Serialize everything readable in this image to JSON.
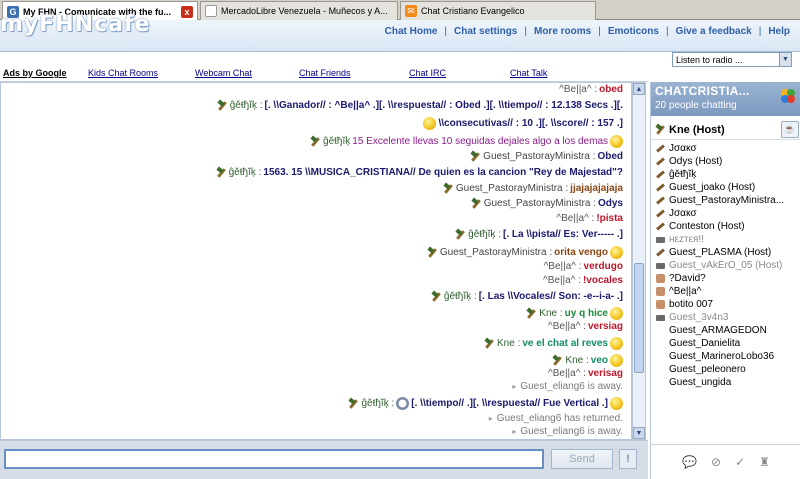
{
  "browser": {
    "tabs": [
      {
        "title": "My FHN - Comunicate with the fu...",
        "active": true,
        "icon": "browser-g-icon",
        "icon_color": "#3a6fb0"
      },
      {
        "title": "MercadoLibre Venezuela - Muñecos y A...",
        "active": false,
        "icon": "document-icon",
        "icon_color": "#9a9a9a"
      },
      {
        "title": "Chat Cristiano Evangelico",
        "active": false,
        "icon": "messenger-icon",
        "icon_color": "#f08a1c"
      }
    ],
    "close_glyph": "x"
  },
  "header": {
    "logo_text": "myFHNcafe",
    "nav": [
      "Chat Home",
      "Chat settings",
      "More rooms",
      "Emoticons",
      "Give a feedback",
      "Help"
    ]
  },
  "ads": {
    "title": "Ads by Google",
    "links": [
      "Kids Chat Rooms",
      "Webcam Chat",
      "Chat Friends",
      "Chat IRC",
      "Chat Talk"
    ]
  },
  "radio": {
    "selected": "Listen to radio ..."
  },
  "chat": {
    "lines": [
      {
        "nick": "^Be||a^ :",
        "msg": "obed",
        "style": "msg-red"
      },
      {
        "nick": "ĝěŧђĭķ :",
        "msg": "[. \\\\Ganador// : ^Be||a^ .][. \\\\respuesta// : Obed .][. \\\\tiempo// : 12.138 Secs .][.",
        "style": "msg-navy"
      },
      {
        "nick": "",
        "msg": "\\\\consecutivas// : 10 .][. \\\\score// : 157 .]",
        "style": "msg-navy"
      },
      {
        "nick": "ĝěŧђĭķ",
        "msg": "15 Excelente llevas 10 seguidas dejales algo a los demas",
        "style": "msg-purple"
      },
      {
        "nick": "Guest_PastorayMinistra :",
        "msg": "Obed",
        "style": "msg-dark"
      },
      {
        "nick": "ĝěŧђĭķ :",
        "msg": "1563. 15 \\\\MUSICA_CRISTIANA// De quien es la cancion \"Rey de Majestad\"?",
        "style": "msg-navy"
      },
      {
        "nick": "Guest_PastorayMinistra :",
        "msg": "jjajajajajaja",
        "style": "msg-brown"
      },
      {
        "nick": "Guest_PastorayMinistra :",
        "msg": "Odys",
        "style": "msg-dark"
      },
      {
        "nick": "^Be||a^ :",
        "msg": "!pista",
        "style": "msg-red"
      },
      {
        "nick": "ĝěŧђĭķ :",
        "msg": "[. La \\\\pista// Es: Ver----- .]",
        "style": "msg-navy"
      },
      {
        "nick": "Guest_PastorayMinistra :",
        "msg": "orita vengo",
        "style": "msg-brown"
      },
      {
        "nick": "^Be||a^ :",
        "msg": "verdugo",
        "style": "msg-red"
      },
      {
        "nick": "^Be||a^ :",
        "msg": "!vocales",
        "style": "msg-red"
      },
      {
        "nick": "ĝěŧђĭķ :",
        "msg": "[. Las \\\\Vocales// Son: -e--i-a- .]",
        "style": "msg-navy"
      },
      {
        "nick": "Kne :",
        "msg": "uy q hice",
        "style": "msg-green"
      },
      {
        "nick": "^Be||a^ :",
        "msg": "versiag",
        "style": "msg-red"
      },
      {
        "nick": "Kne :",
        "msg": "ve el chat al reves",
        "style": "msg-teal"
      },
      {
        "nick": "Kne :",
        "msg": "veo",
        "style": "msg-teal"
      },
      {
        "nick": "^Be||a^ :",
        "msg": "verisag",
        "style": "msg-red"
      },
      {
        "nick": "",
        "msg": "Guest_eliang6 is away.",
        "style": "sys"
      },
      {
        "nick": "ĝěŧђĭķ :",
        "msg": "[. \\\\tiempo// .][. \\\\respuesta// Fue Vertical .]",
        "style": "msg-navy"
      },
      {
        "nick": "",
        "msg": "Guest_eliang6 has returned.",
        "style": "sys"
      },
      {
        "nick": "",
        "msg": "Guest_eliang6 is away.",
        "style": "sys"
      }
    ]
  },
  "room": {
    "title": "CHATCRISTIA...",
    "count_text": "20 people chatting",
    "host": "Kne (Host)",
    "users": [
      {
        "name": "Jσαкσ",
        "icon": "hammer",
        "grayed": false
      },
      {
        "name": "Odys (Host)",
        "icon": "hammer",
        "grayed": false
      },
      {
        "name": "ĝěŧђĭķ",
        "icon": "hammer",
        "grayed": false
      },
      {
        "name": "Guest_joako (Host)",
        "icon": "hammer",
        "grayed": false
      },
      {
        "name": "Guest_PastorayMinistra...",
        "icon": "hammer",
        "grayed": false
      },
      {
        "name": "Jσαкσ",
        "icon": "hammer",
        "grayed": false
      },
      {
        "name": "Conteston (Host)",
        "icon": "hammer",
        "grayed": false
      },
      {
        "name": "нεzтεя!!",
        "icon": "cam",
        "grayed": true
      },
      {
        "name": "Guest_PLASMA (Host)",
        "icon": "hammer",
        "grayed": false
      },
      {
        "name": "Guest_vAkErO_05 (Host)",
        "icon": "cam",
        "grayed": true
      },
      {
        "name": "?David?",
        "icon": "face",
        "grayed": false
      },
      {
        "name": "^Be||a^",
        "icon": "face",
        "grayed": false
      },
      {
        "name": "botito 007",
        "icon": "face",
        "grayed": false
      },
      {
        "name": "Guest_3v4n3",
        "icon": "cam",
        "grayed": true
      },
      {
        "name": "Guest_ARMAGEDON",
        "icon": "",
        "grayed": false
      },
      {
        "name": "Guest_Danielita",
        "icon": "",
        "grayed": false
      },
      {
        "name": "Guest_MarineroLobo36",
        "icon": "",
        "grayed": false
      },
      {
        "name": "Guest_peleonero",
        "icon": "",
        "grayed": false
      },
      {
        "name": "Guest_ungida",
        "icon": "",
        "grayed": false
      }
    ]
  },
  "input": {
    "value": "",
    "send_label": "Send",
    "excl_label": "!"
  },
  "colors": {
    "nav_blue": "#2f5fa8",
    "room_header": "#7b98bf",
    "input_border": "#6a8fc4"
  }
}
